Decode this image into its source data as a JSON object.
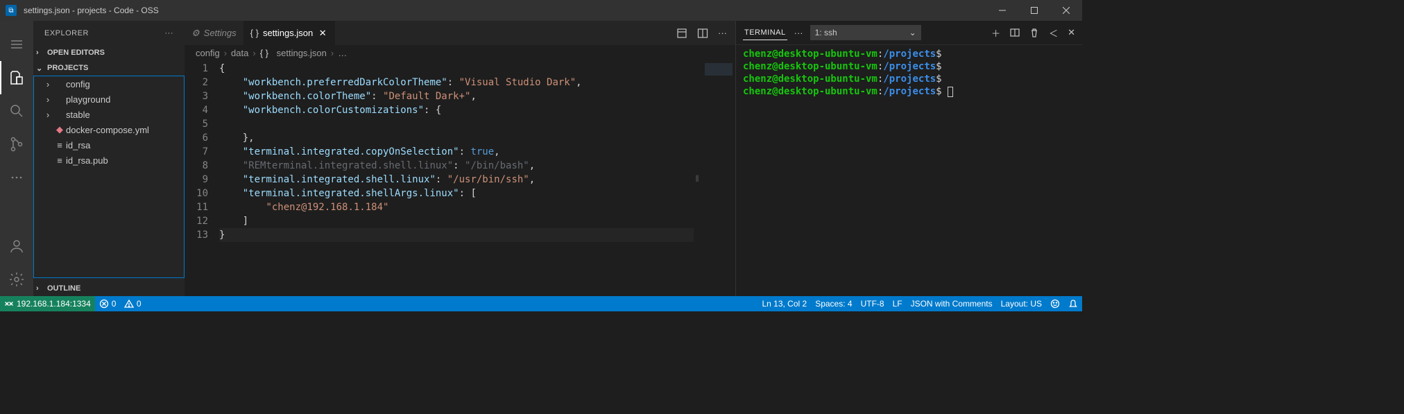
{
  "titlebar": {
    "title": "settings.json - projects - Code - OSS"
  },
  "activity": {
    "items": [
      "menu",
      "explorer",
      "search",
      "scm",
      "more",
      "account",
      "settings"
    ]
  },
  "sidebar": {
    "title": "EXPLORER",
    "sections": {
      "openEditors": "OPEN EDITORS",
      "project": "PROJECTS",
      "outline": "OUTLINE"
    },
    "tree": [
      {
        "label": "config",
        "kind": "folder"
      },
      {
        "label": "playground",
        "kind": "folder"
      },
      {
        "label": "stable",
        "kind": "folder"
      },
      {
        "label": "docker-compose.yml",
        "kind": "docker"
      },
      {
        "label": "id_rsa",
        "kind": "file"
      },
      {
        "label": "id_rsa.pub",
        "kind": "file"
      }
    ]
  },
  "tabs": [
    {
      "label": "Settings",
      "icon": "settings",
      "active": false
    },
    {
      "label": "settings.json",
      "icon": "json",
      "active": true
    }
  ],
  "breadcrumbs": [
    "config",
    "data",
    "settings.json",
    "…"
  ],
  "code": {
    "lines": [
      {
        "n": 1,
        "text": "{",
        "kind": "brace"
      },
      {
        "n": 2,
        "key": "workbench.preferredDarkColorTheme",
        "val": "Visual Studio Dark",
        "comma": true
      },
      {
        "n": 3,
        "key": "workbench.colorTheme",
        "val": "Default Dark+",
        "comma": true
      },
      {
        "n": 4,
        "key": "workbench.colorCustomizations",
        "open": "{"
      },
      {
        "n": 5,
        "blank": true
      },
      {
        "n": 6,
        "close": "},",
        "indent": 1
      },
      {
        "n": 7,
        "key": "terminal.integrated.copyOnSelection",
        "bool": "true",
        "comma": true
      },
      {
        "n": 8,
        "key": "REMterminal.integrated.shell.linux",
        "val": "/bin/bash",
        "comma": true,
        "dim": true
      },
      {
        "n": 9,
        "key": "terminal.integrated.shell.linux",
        "val": "/usr/bin/ssh",
        "comma": true
      },
      {
        "n": 10,
        "key": "terminal.integrated.shellArgs.linux",
        "open": "["
      },
      {
        "n": 11,
        "arr": "chenz@192.168.1.184"
      },
      {
        "n": 12,
        "close": "]",
        "indent": 1
      },
      {
        "n": 13,
        "text": "}",
        "kind": "brace",
        "cursor": true
      }
    ]
  },
  "terminal": {
    "tab": "TERMINAL",
    "select": "1: ssh",
    "prompt": {
      "user": "chenz@desktop-ubuntu-vm",
      "path": "/projects",
      "sym": "$"
    },
    "lineCount": 4
  },
  "status": {
    "remote": "192.168.1.184:1334",
    "errors": "0",
    "warnings": "0",
    "lncol": "Ln 13, Col 2",
    "spaces": "Spaces: 4",
    "encoding": "UTF-8",
    "eol": "LF",
    "lang": "JSON with Comments",
    "layout": "Layout: US"
  }
}
